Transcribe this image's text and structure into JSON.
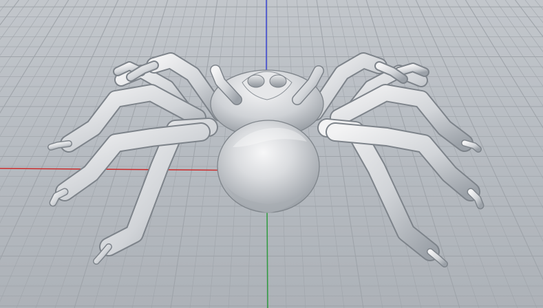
{
  "viewport": {
    "background": "#b9bec4",
    "grid_color": "#9ea3a9",
    "axis_colors": {
      "x": "#cc2a2a",
      "y": "#2f9b3f",
      "z": "#3c48d6"
    }
  },
  "model": {
    "icon": "spider-mesh",
    "surface_color": "#d6d7d9"
  }
}
